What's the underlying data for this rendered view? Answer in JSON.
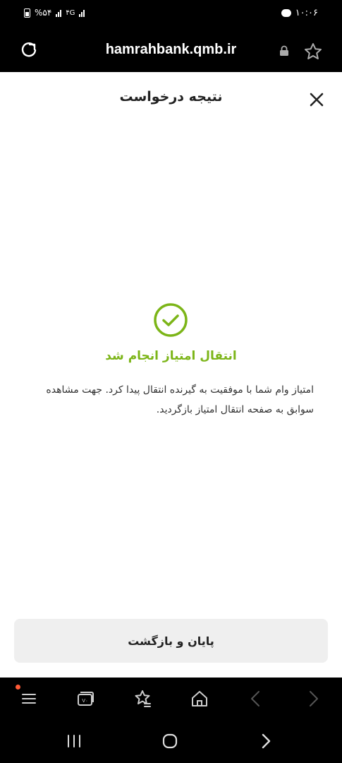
{
  "status_bar": {
    "time": "۱۰:۰۶",
    "battery_percent": "%۵۴",
    "network_label": "۴G"
  },
  "browser": {
    "url": "hamrahbank.qmb.ir"
  },
  "page": {
    "header_title": "نتیجه درخواست",
    "success_title": "انتقال امتیاز انجام شد",
    "message": "امتیاز وام شما با موفقیت به گیرنده انتقال پیدا کرد. جهت مشاهده سوابق به صفحه انتقال امتیاز بازگردید.",
    "done_button": "پایان و بازگشت"
  },
  "colors": {
    "success": "#7cb518",
    "notification_dot": "#ff5a36",
    "button_bg": "#efefef"
  },
  "icons": {
    "toolbar": [
      "menu-icon",
      "tabs-icon",
      "bookmarks-icon",
      "home-icon",
      "back-icon",
      "forward-icon"
    ],
    "system_nav": [
      "recent-apps-icon",
      "home-circle-icon",
      "back-arrow-icon"
    ]
  },
  "tab_count": "V۰"
}
